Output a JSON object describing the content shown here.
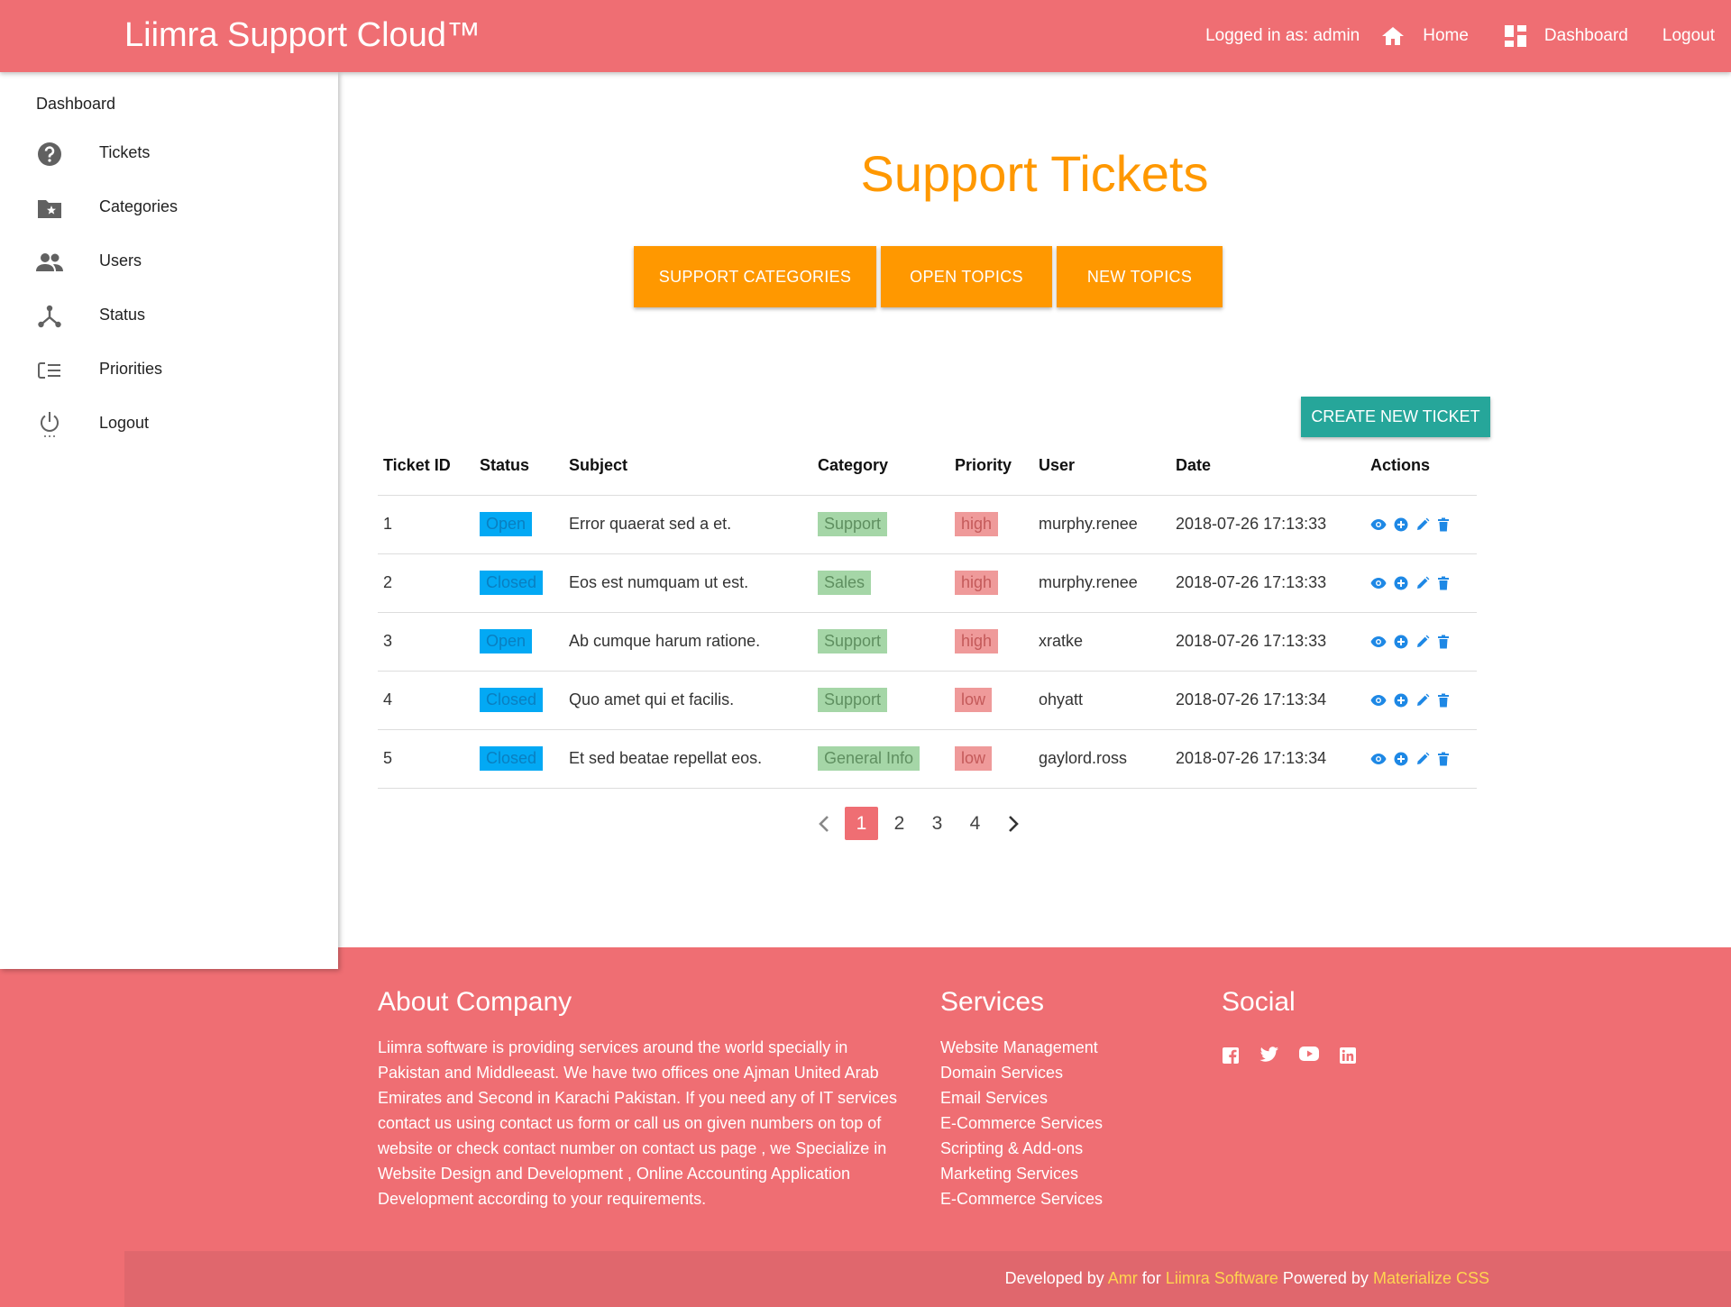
{
  "header": {
    "brand": "Liimra Support Cloud™",
    "logged_in": "Logged in as: admin",
    "home": "Home",
    "dashboard": "Dashboard",
    "logout": "Logout"
  },
  "sidebar": {
    "dashboard": "Dashboard",
    "items": [
      {
        "label": "Tickets",
        "icon": "help-circle-icon"
      },
      {
        "label": "Categories",
        "icon": "folder-star-icon"
      },
      {
        "label": "Users",
        "icon": "people-icon"
      },
      {
        "label": "Status",
        "icon": "branch-icon"
      },
      {
        "label": "Priorities",
        "icon": "priority-list-icon"
      },
      {
        "label": "Logout",
        "icon": "power-icon"
      }
    ]
  },
  "main": {
    "title": "Support Tickets",
    "buttons": {
      "categories": "SUPPORT CATEGORIES",
      "open": "OPEN TOPICS",
      "new": "NEW TOPICS",
      "create": "CREATE NEW TICKET"
    },
    "table": {
      "headers": [
        "Ticket ID",
        "Status",
        "Subject",
        "Category",
        "Priority",
        "User",
        "Date",
        "Actions"
      ],
      "rows": [
        {
          "id": "1",
          "status": "Open",
          "subject": "Error quaerat sed a et.",
          "category": "Support",
          "priority": "high",
          "user": "murphy.renee",
          "date": "2018-07-26 17:13:33"
        },
        {
          "id": "2",
          "status": "Closed",
          "subject": "Eos est numquam ut est.",
          "category": "Sales",
          "priority": "high",
          "user": "murphy.renee",
          "date": "2018-07-26 17:13:33"
        },
        {
          "id": "3",
          "status": "Open",
          "subject": "Ab cumque harum ratione.",
          "category": "Support",
          "priority": "high",
          "user": "xratke",
          "date": "2018-07-26 17:13:33"
        },
        {
          "id": "4",
          "status": "Closed",
          "subject": "Quo amet qui et facilis.",
          "category": "Support",
          "priority": "low",
          "user": "ohyatt",
          "date": "2018-07-26 17:13:34"
        },
        {
          "id": "5",
          "status": "Closed",
          "subject": "Et sed beatae repellat eos.",
          "category": "General Info",
          "priority": "low",
          "user": "gaylord.ross",
          "date": "2018-07-26 17:13:34"
        }
      ]
    },
    "pagination": {
      "pages": [
        "1",
        "2",
        "3",
        "4"
      ],
      "current": "1"
    }
  },
  "footer": {
    "about_title": "About Company",
    "about_text": "Liimra software is providing services around the world specially in Pakistan and Middleeast. We have two offices one Ajman United Arab Emirates and Second in Karachi Pakistan. If you need any of IT services contact us using contact us form or call us on given numbers on top of website or check contact number on contact us page , we Specialize in Website Design and Development , Online Accounting Application Development according to your requirements.",
    "services_title": "Services",
    "services": [
      "Website Management",
      "Domain Services",
      "Email Services",
      "E-Commerce Services",
      "Scripting & Add-ons",
      "Marketing Services",
      "E-Commerce Services"
    ],
    "social_title": "Social",
    "social_icons": [
      "facebook-icon",
      "twitter-icon",
      "youtube-icon",
      "linkedin-icon"
    ],
    "credits": {
      "developed_by": "Developed by",
      "author": "Amr",
      "for": "for",
      "company": "Liimra Software",
      "powered_by": "Powered by",
      "framework": "Materialize CSS"
    }
  },
  "colors": {
    "primary": "#ef6e73",
    "accent_orange": "#ff9800",
    "teal": "#26a69a",
    "status_blue": "#03a9f4",
    "category_green": "#a5d6a7",
    "priority_red": "#ef9a9a",
    "action_blue": "#1e88e5",
    "credit_yellow": "#ffd54f"
  }
}
